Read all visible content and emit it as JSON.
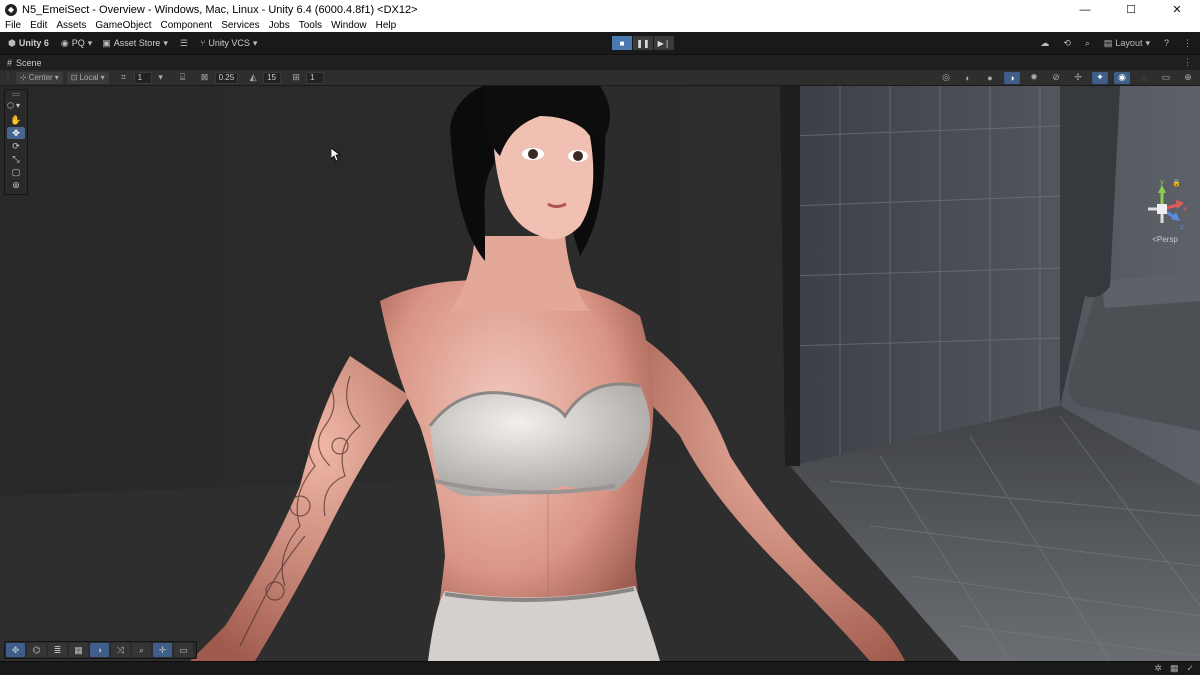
{
  "window": {
    "title": "N5_EmeiSect - Overview - Windows, Mac, Linux - Unity 6.4 (6000.4.8f1) <DX12>",
    "controls": [
      "—",
      "☐",
      "✕"
    ]
  },
  "menu": [
    "File",
    "Edit",
    "Assets",
    "GameObject",
    "Component",
    "Services",
    "Jobs",
    "Tools",
    "Window",
    "Help"
  ],
  "toolbar": {
    "account": "Unity 6",
    "user": "PQ",
    "asset_store": "Asset Store",
    "vcs": "Unity VCS",
    "layout": "Layout"
  },
  "scene_tab": {
    "label": "Scene"
  },
  "scene_toolbar": {
    "pivot": "Center",
    "space": "Local",
    "move_snap": "1",
    "scale_snap": "0.25",
    "rotate_snap": "15",
    "grid_count": "1"
  },
  "gizmo": {
    "projection": "<Persp",
    "axes": [
      "y",
      "x",
      "z"
    ]
  },
  "colors": {
    "accent": "#4d79b3",
    "background": "#191919"
  }
}
